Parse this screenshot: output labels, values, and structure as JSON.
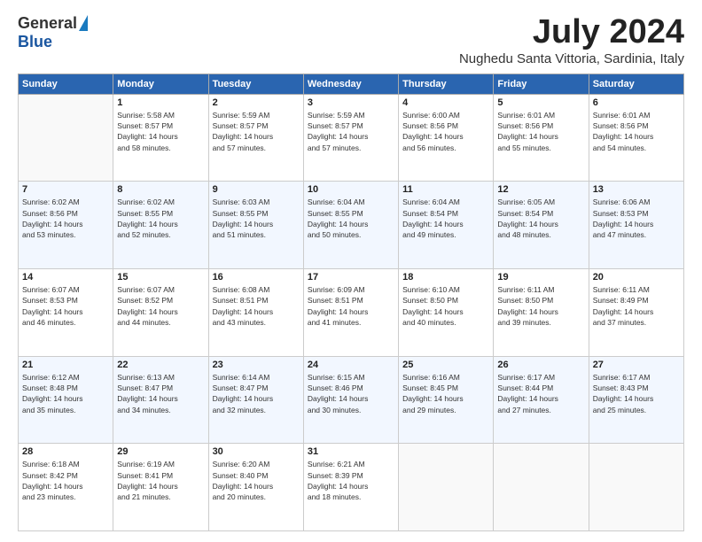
{
  "logo": {
    "general": "General",
    "blue": "Blue"
  },
  "title": "July 2024",
  "location": "Nughedu Santa Vittoria, Sardinia, Italy",
  "weekdays": [
    "Sunday",
    "Monday",
    "Tuesday",
    "Wednesday",
    "Thursday",
    "Friday",
    "Saturday"
  ],
  "weeks": [
    [
      {
        "day": "",
        "info": ""
      },
      {
        "day": "1",
        "info": "Sunrise: 5:58 AM\nSunset: 8:57 PM\nDaylight: 14 hours\nand 58 minutes."
      },
      {
        "day": "2",
        "info": "Sunrise: 5:59 AM\nSunset: 8:57 PM\nDaylight: 14 hours\nand 57 minutes."
      },
      {
        "day": "3",
        "info": "Sunrise: 5:59 AM\nSunset: 8:57 PM\nDaylight: 14 hours\nand 57 minutes."
      },
      {
        "day": "4",
        "info": "Sunrise: 6:00 AM\nSunset: 8:56 PM\nDaylight: 14 hours\nand 56 minutes."
      },
      {
        "day": "5",
        "info": "Sunrise: 6:01 AM\nSunset: 8:56 PM\nDaylight: 14 hours\nand 55 minutes."
      },
      {
        "day": "6",
        "info": "Sunrise: 6:01 AM\nSunset: 8:56 PM\nDaylight: 14 hours\nand 54 minutes."
      }
    ],
    [
      {
        "day": "7",
        "info": "Sunrise: 6:02 AM\nSunset: 8:56 PM\nDaylight: 14 hours\nand 53 minutes."
      },
      {
        "day": "8",
        "info": "Sunrise: 6:02 AM\nSunset: 8:55 PM\nDaylight: 14 hours\nand 52 minutes."
      },
      {
        "day": "9",
        "info": "Sunrise: 6:03 AM\nSunset: 8:55 PM\nDaylight: 14 hours\nand 51 minutes."
      },
      {
        "day": "10",
        "info": "Sunrise: 6:04 AM\nSunset: 8:55 PM\nDaylight: 14 hours\nand 50 minutes."
      },
      {
        "day": "11",
        "info": "Sunrise: 6:04 AM\nSunset: 8:54 PM\nDaylight: 14 hours\nand 49 minutes."
      },
      {
        "day": "12",
        "info": "Sunrise: 6:05 AM\nSunset: 8:54 PM\nDaylight: 14 hours\nand 48 minutes."
      },
      {
        "day": "13",
        "info": "Sunrise: 6:06 AM\nSunset: 8:53 PM\nDaylight: 14 hours\nand 47 minutes."
      }
    ],
    [
      {
        "day": "14",
        "info": "Sunrise: 6:07 AM\nSunset: 8:53 PM\nDaylight: 14 hours\nand 46 minutes."
      },
      {
        "day": "15",
        "info": "Sunrise: 6:07 AM\nSunset: 8:52 PM\nDaylight: 14 hours\nand 44 minutes."
      },
      {
        "day": "16",
        "info": "Sunrise: 6:08 AM\nSunset: 8:51 PM\nDaylight: 14 hours\nand 43 minutes."
      },
      {
        "day": "17",
        "info": "Sunrise: 6:09 AM\nSunset: 8:51 PM\nDaylight: 14 hours\nand 41 minutes."
      },
      {
        "day": "18",
        "info": "Sunrise: 6:10 AM\nSunset: 8:50 PM\nDaylight: 14 hours\nand 40 minutes."
      },
      {
        "day": "19",
        "info": "Sunrise: 6:11 AM\nSunset: 8:50 PM\nDaylight: 14 hours\nand 39 minutes."
      },
      {
        "day": "20",
        "info": "Sunrise: 6:11 AM\nSunset: 8:49 PM\nDaylight: 14 hours\nand 37 minutes."
      }
    ],
    [
      {
        "day": "21",
        "info": "Sunrise: 6:12 AM\nSunset: 8:48 PM\nDaylight: 14 hours\nand 35 minutes."
      },
      {
        "day": "22",
        "info": "Sunrise: 6:13 AM\nSunset: 8:47 PM\nDaylight: 14 hours\nand 34 minutes."
      },
      {
        "day": "23",
        "info": "Sunrise: 6:14 AM\nSunset: 8:47 PM\nDaylight: 14 hours\nand 32 minutes."
      },
      {
        "day": "24",
        "info": "Sunrise: 6:15 AM\nSunset: 8:46 PM\nDaylight: 14 hours\nand 30 minutes."
      },
      {
        "day": "25",
        "info": "Sunrise: 6:16 AM\nSunset: 8:45 PM\nDaylight: 14 hours\nand 29 minutes."
      },
      {
        "day": "26",
        "info": "Sunrise: 6:17 AM\nSunset: 8:44 PM\nDaylight: 14 hours\nand 27 minutes."
      },
      {
        "day": "27",
        "info": "Sunrise: 6:17 AM\nSunset: 8:43 PM\nDaylight: 14 hours\nand 25 minutes."
      }
    ],
    [
      {
        "day": "28",
        "info": "Sunrise: 6:18 AM\nSunset: 8:42 PM\nDaylight: 14 hours\nand 23 minutes."
      },
      {
        "day": "29",
        "info": "Sunrise: 6:19 AM\nSunset: 8:41 PM\nDaylight: 14 hours\nand 21 minutes."
      },
      {
        "day": "30",
        "info": "Sunrise: 6:20 AM\nSunset: 8:40 PM\nDaylight: 14 hours\nand 20 minutes."
      },
      {
        "day": "31",
        "info": "Sunrise: 6:21 AM\nSunset: 8:39 PM\nDaylight: 14 hours\nand 18 minutes."
      },
      {
        "day": "",
        "info": ""
      },
      {
        "day": "",
        "info": ""
      },
      {
        "day": "",
        "info": ""
      }
    ]
  ]
}
